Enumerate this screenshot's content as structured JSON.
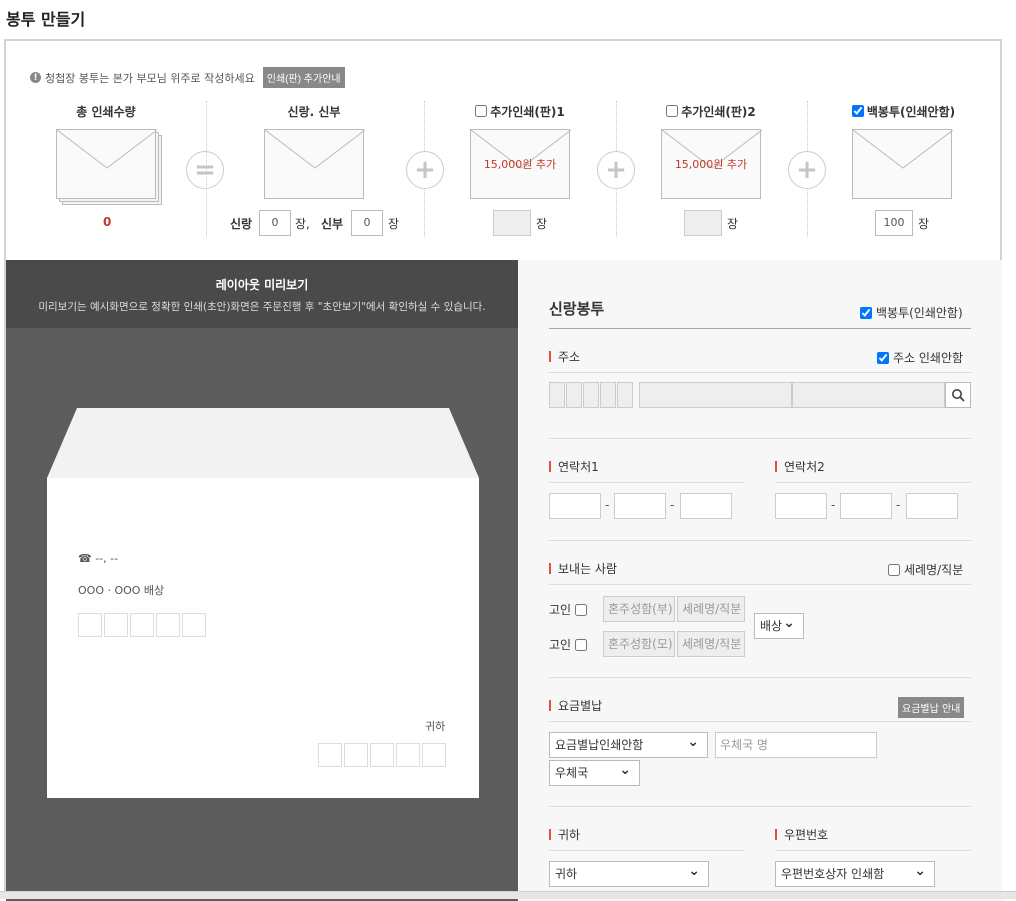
{
  "page_title": "봉투 만들기",
  "notice": {
    "text": "청첩장 봉투는 본가 부모님 위주로 작성하세요",
    "guide_button": "인쇄(판) 추가안내"
  },
  "columns": {
    "total": {
      "title": "총 인쇄수량",
      "qty": "0"
    },
    "couple": {
      "title": "신랑. 신부",
      "groom_label": "신랑",
      "groom_qty": "0",
      "unit1": "장,",
      "bride_label": "신부",
      "bride_qty": "0",
      "unit2": "장"
    },
    "extra1": {
      "title": "추가인쇄(판)1",
      "price": "15,000원 추가",
      "unit": "장"
    },
    "extra2": {
      "title": "추가인쇄(판)2",
      "price": "15,000원 추가",
      "unit": "장"
    },
    "blank": {
      "title": "백봉투(인쇄안함)",
      "qty": "100",
      "unit": "장"
    }
  },
  "preview": {
    "title": "레이아웃 미리보기",
    "desc": "미리보기는 예시화면으로 정확한 인쇄(초안)화면은 주문진행 후 \"초안보기\"에서 확인하실 수 있습니다.",
    "phone": "☎ --, --",
    "sender": "OOO · OOO 배상",
    "honorific": "귀하"
  },
  "form": {
    "title": "신랑봉투",
    "blank_envelope": "백봉투(인쇄안함)",
    "address": {
      "label": "주소",
      "no_print": "주소 인쇄안함"
    },
    "contact1": {
      "label": "연락처1"
    },
    "contact2": {
      "label": "연락처2"
    },
    "sender": {
      "label": "보내는 사람",
      "title_option": "세례명/직분",
      "deceased": "고인",
      "father_ph": "혼주성함(부)",
      "mother_ph": "혼주성함(모)",
      "baptism_ph": "세례명/직분",
      "closing": "배상"
    },
    "postage": {
      "label": "요금별납",
      "guide_button": "요금별납 안내",
      "select": "요금별납인쇄안함",
      "office_ph": "우체국 명",
      "office_select": "우체국"
    },
    "honorific": {
      "label": "귀하",
      "select": "귀하"
    },
    "zipcode": {
      "label": "우편번호",
      "select": "우편번호상자 인쇄함"
    }
  }
}
